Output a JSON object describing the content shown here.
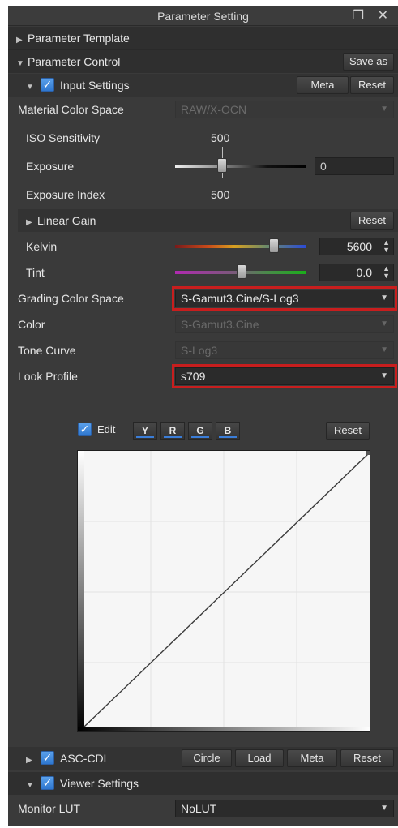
{
  "window": {
    "title": "Parameter Setting",
    "controls": "❐ ✕"
  },
  "template": {
    "label": "Parameter Template"
  },
  "control": {
    "label": "Parameter Control",
    "save_as": "Save as"
  },
  "input": {
    "label": "Input Settings",
    "meta": "Meta",
    "reset": "Reset",
    "material_color_space": {
      "label": "Material Color Space",
      "value": "RAW/X-OCN"
    },
    "iso": {
      "label": "ISO Sensitivity",
      "value": "500"
    },
    "exposure": {
      "label": "Exposure",
      "value": "0"
    },
    "exposure_index": {
      "label": "Exposure Index",
      "value": "500"
    },
    "linear_gain": {
      "label": "Linear Gain",
      "reset": "Reset"
    },
    "kelvin": {
      "label": "Kelvin",
      "value": "5600"
    },
    "tint": {
      "label": "Tint",
      "value": "0.0"
    },
    "grading_color_space": {
      "label": "Grading Color Space",
      "value": "S-Gamut3.Cine/S-Log3"
    },
    "color": {
      "label": "Color",
      "value": "S-Gamut3.Cine"
    },
    "tone_curve": {
      "label": "Tone Curve",
      "value": "S-Log3"
    },
    "look_profile": {
      "label": "Look Profile",
      "value": "s709"
    }
  },
  "curve": {
    "edit_label": "Edit",
    "channels": [
      "Y",
      "R",
      "G",
      "B"
    ],
    "reset": "Reset"
  },
  "asc_cdl": {
    "label": "ASC-CDL",
    "circle": "Circle",
    "load": "Load",
    "meta": "Meta",
    "reset": "Reset"
  },
  "viewer": {
    "label": "Viewer Settings"
  },
  "monitor_lut": {
    "label": "Monitor LUT",
    "value": "NoLUT"
  },
  "colors": {
    "highlight": "#c81e1e",
    "check": "#3a7dd8",
    "panel": "#3a3a3a"
  }
}
